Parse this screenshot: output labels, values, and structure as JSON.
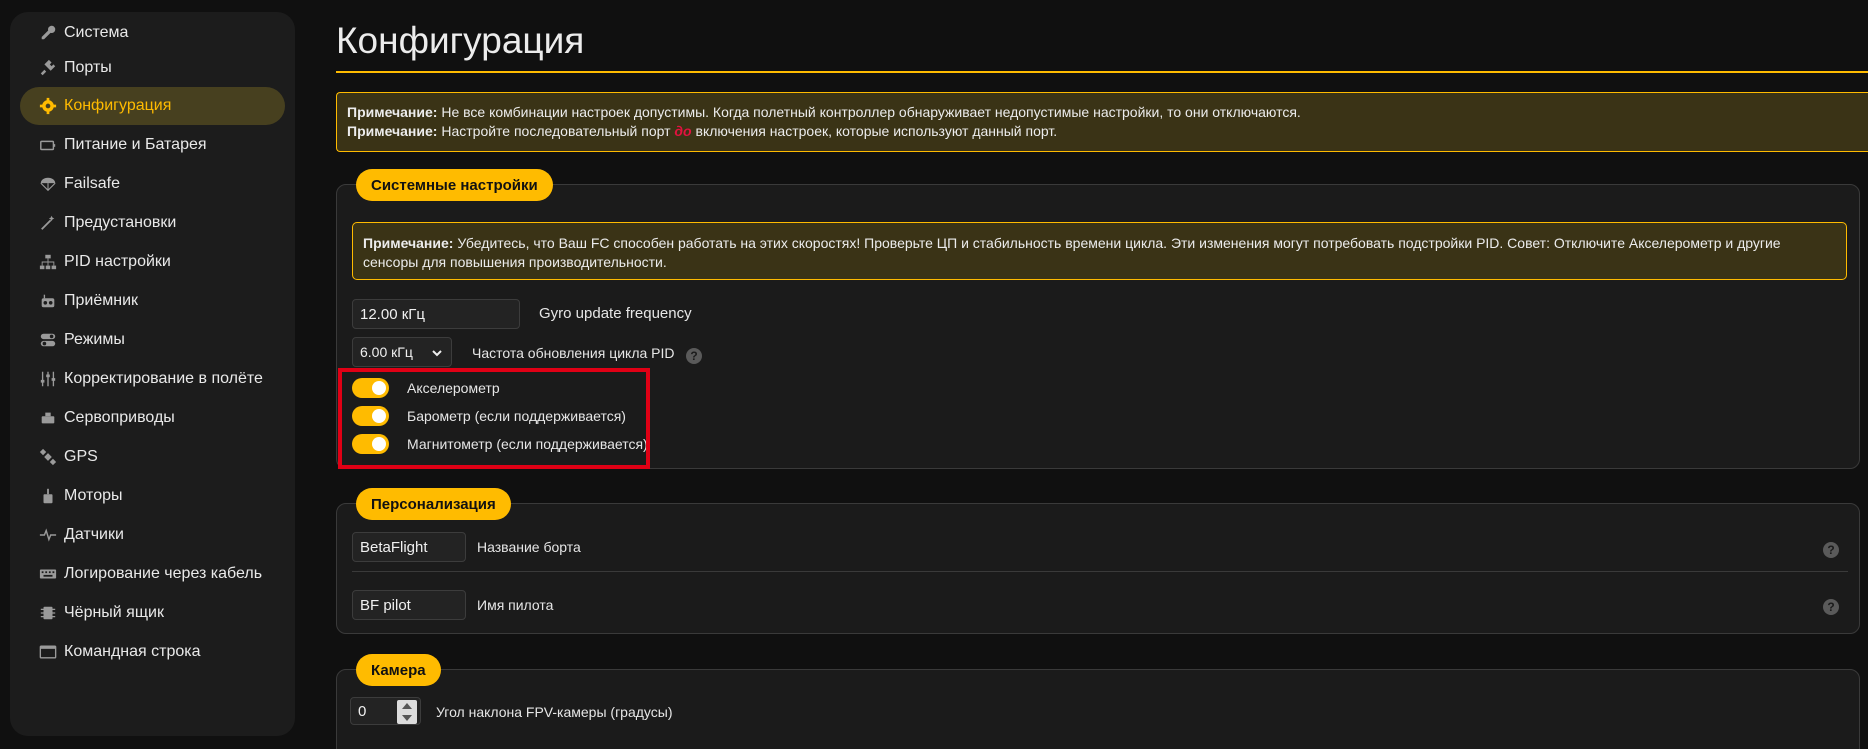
{
  "sidebar": {
    "items": [
      {
        "label": "Система",
        "icon": "wrench-icon"
      },
      {
        "label": "Порты",
        "icon": "plug-icon"
      },
      {
        "label": "Конфигурация",
        "icon": "gear-icon"
      },
      {
        "label": "Питание и Батарея",
        "icon": "battery-icon"
      },
      {
        "label": "Failsafe",
        "icon": "parachute-icon"
      },
      {
        "label": "Предустановки",
        "icon": "magic-wand-icon"
      },
      {
        "label": "PID настройки",
        "icon": "sitemap-icon"
      },
      {
        "label": "Приёмник",
        "icon": "radio-icon"
      },
      {
        "label": "Режимы",
        "icon": "toggles-icon"
      },
      {
        "label": "Корректирование в полёте",
        "icon": "sliders-icon"
      },
      {
        "label": "Сервоприводы",
        "icon": "servo-icon"
      },
      {
        "label": "GPS",
        "icon": "satellite-icon"
      },
      {
        "label": "Моторы",
        "icon": "motor-icon"
      },
      {
        "label": "Датчики",
        "icon": "pulse-icon"
      },
      {
        "label": "Логирование через кабель",
        "icon": "keyboard-icon"
      },
      {
        "label": "Чёрный ящик",
        "icon": "chip-icon"
      },
      {
        "label": "Командная строка",
        "icon": "terminal-icon"
      }
    ],
    "active_index": 2
  },
  "page": {
    "title": "Конфигурация"
  },
  "top_note": {
    "line1_bold": "Примечание:",
    "line1_text": " Не все комбинации настроек допустимы. Когда полетный контроллер обнаруживает недопустимые настройки, то они отключаются.",
    "line2_bold": "Примечание:",
    "line2_pre": " Настройте последовательный порт ",
    "line2_red": "до",
    "line2_post": " включения настроек, которые используют данный порт."
  },
  "system": {
    "header": "Системные настройки",
    "note_bold": "Примечание:",
    "note_text": " Убедитесь, что Ваш FC способен работать на этих скоростях! Проверьте ЦП и стабильность времени цикла. Эти изменения могут потребовать подстройки PID. Совет: Отключите Акселерометр и другие сенсоры для повышения производительности.",
    "gyro_value": "12.00 кГц",
    "gyro_label": "Gyro update frequency",
    "pid_value": "6.00 кГц",
    "pid_label": "Частота обновления цикла PID",
    "toggles": [
      {
        "label": "Акселерометр",
        "on": true
      },
      {
        "label": "Барометр (если поддерживается)",
        "on": true
      },
      {
        "label": "Магнитометр (если поддерживается)",
        "on": true
      }
    ]
  },
  "personalization": {
    "header": "Персонализация",
    "craft_value": "BetaFlight",
    "craft_label": "Название борта",
    "pilot_value": "BF pilot",
    "pilot_label": "Имя пилота"
  },
  "camera": {
    "header": "Камера",
    "angle_value": "0",
    "angle_label": "Угол наклона FPV-камеры (градусы)"
  },
  "colors": {
    "accent": "#ffbb00",
    "highlight_frame": "#e00015",
    "background": "#101010"
  }
}
